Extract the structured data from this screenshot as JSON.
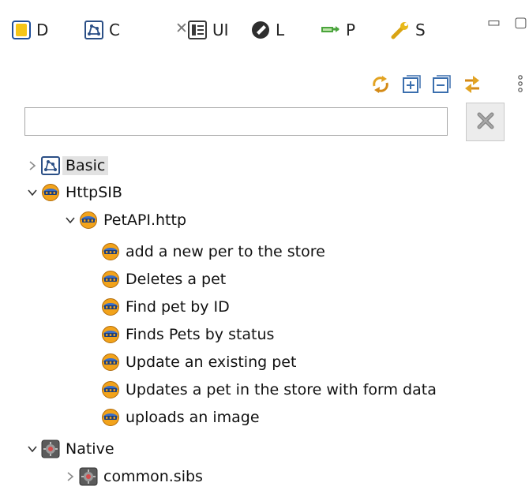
{
  "tabs": [
    {
      "label": "D",
      "icon": "database-icon"
    },
    {
      "label": "C",
      "icon": "component-icon",
      "active": true
    },
    {
      "label": "UI",
      "icon": "ui-form-icon"
    },
    {
      "label": "L",
      "icon": "library-icon"
    },
    {
      "label": "P",
      "icon": "process-icon"
    },
    {
      "label": "S",
      "icon": "wrench-icon"
    }
  ],
  "filter": {
    "value": "",
    "placeholder": ""
  },
  "tree": {
    "basic": "Basic",
    "httpsib": "HttpSIB",
    "petapi": "PetAPI.http",
    "operations": [
      "add a new per to the store",
      "Deletes a pet",
      "Find pet by ID",
      "Finds Pets by status",
      "Update an existing pet",
      "Updates a pet in the store with form data",
      "uploads an image"
    ],
    "native": "Native",
    "common": "common.sibs"
  },
  "colors": {
    "accent": "#2b6fd6",
    "sib_orange": "#f2a31b",
    "selection": "#e2e2e2"
  }
}
